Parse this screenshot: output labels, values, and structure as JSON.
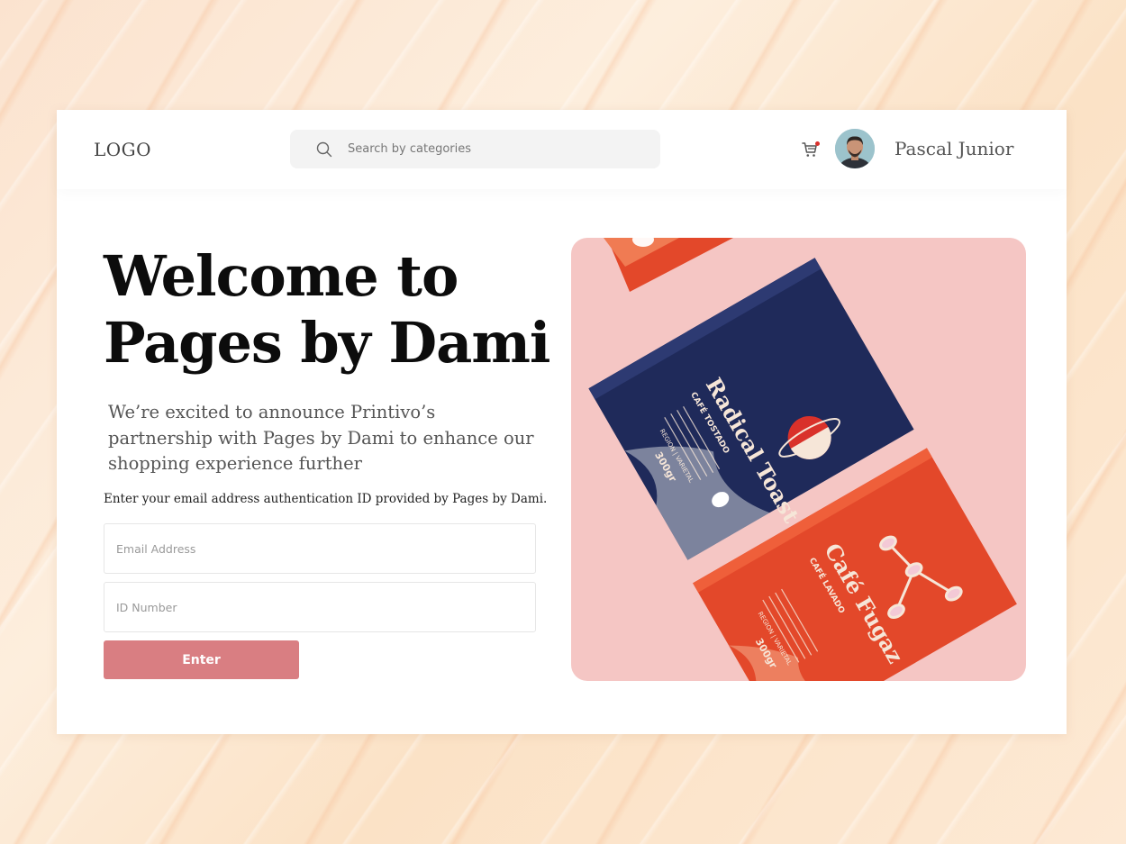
{
  "header": {
    "logo": "LOGO",
    "search_placeholder": "Search by categories",
    "user_name": "Pascal Junior"
  },
  "main": {
    "headline_line1": "Welcome to",
    "headline_line2": "Pages by Dami",
    "announcement": "We’re excited to announce Printivo’s partnership with Pages by Dami to enhance our shopping experience further",
    "instruction": "Enter your email address authentication ID provided by Pages by Dami.",
    "email_placeholder": "Email Address",
    "id_placeholder": "ID Number",
    "enter_label": "Enter"
  },
  "hero": {
    "bag1": {
      "title": "Radical Toast",
      "subtitle": "CAFÉ TOSTADO",
      "weight": "300gr",
      "region": "REGION | VARIETAL"
    },
    "bag2": {
      "title": "Café Fugaz",
      "subtitle": "CAFÉ LAVADO",
      "weight": "300gr",
      "region": "REGION | VARIETAL"
    }
  },
  "colors": {
    "accent": "#d97e82",
    "hero_bg": "#f5c6c4",
    "bag_navy": "#1f2a5a",
    "bag_orange": "#e3482a",
    "cart_badge": "#d9302c"
  }
}
